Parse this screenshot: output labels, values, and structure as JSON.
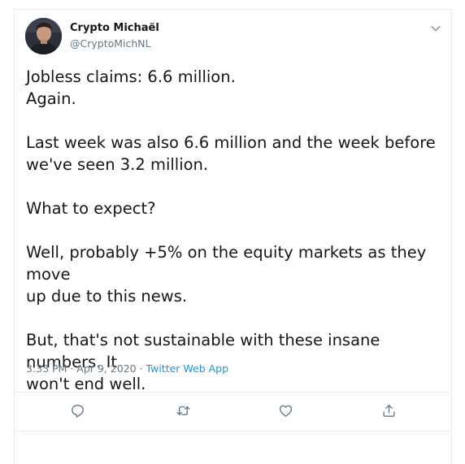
{
  "user": {
    "name": "Crypto Michaël",
    "handle": "@CryptoMichNL",
    "avatar": "avatar-photo"
  },
  "tweet": {
    "paragraphs": [
      {
        "lines": [
          "Jobless claims: 6.6 million.",
          "Again."
        ]
      },
      {
        "lines": [
          "Last week was also 6.6 million and the week before",
          "we've seen 3.2 million."
        ]
      },
      {
        "lines": [
          "What to expect?"
        ]
      },
      {
        "lines": [
          "Well, probably +5% on the equity markets as they move",
          "up due to this news."
        ]
      },
      {
        "lines": [
          "But, that's not sustainable with these insane numbers. It",
          "won't end well."
        ]
      }
    ]
  },
  "meta": {
    "time": "3:33 PM",
    "sep1": " · ",
    "date": "Apr 9, 2020",
    "sep2": " · ",
    "source": "Twitter Web App"
  },
  "actions": {
    "reply": "reply-icon",
    "retweet": "retweet-icon",
    "like": "heart-icon",
    "share": "share-icon"
  },
  "colors": {
    "text": "#14171a",
    "muted": "#657786",
    "link": "#1b95e0",
    "border": "#e6ecf0"
  }
}
